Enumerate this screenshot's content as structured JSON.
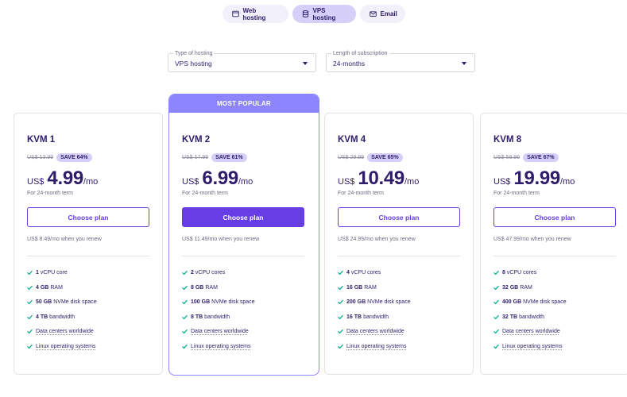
{
  "tabs": [
    {
      "label": "Web hosting",
      "icon": "browser-window-icon",
      "active": false
    },
    {
      "label": "VPS hosting",
      "icon": "server-database-icon",
      "active": true
    },
    {
      "label": "Email",
      "icon": "envelope-icon",
      "active": false
    }
  ],
  "filters": {
    "hosting_type": {
      "label": "Type of hosting",
      "value": "VPS hosting"
    },
    "subscription_length": {
      "label": "Length of subscription",
      "value": "24-months"
    }
  },
  "popular_label": "MOST POPULAR",
  "colors": {
    "accent": "#673de6",
    "popular": "#8c85ff",
    "badge": "#d5cffa",
    "check": "#00b090",
    "text": "#2f1c6a"
  },
  "plans": [
    {
      "name": "KVM 1",
      "old_price": "US$ 13.99",
      "save": "SAVE 64%",
      "currency": "US$",
      "price": "4.99",
      "per": "/mo",
      "term": "For 24-month term",
      "cta": "Choose plan",
      "renew": "US$ 8.49/mo when you renew",
      "features": [
        {
          "bold": "1",
          "text": "vCPU core"
        },
        {
          "bold": "4 GB",
          "text": "RAM"
        },
        {
          "bold": "50 GB",
          "text": "NVMe disk space"
        },
        {
          "bold": "4 TB",
          "text": "bandwidth"
        },
        {
          "bold": "",
          "text": "Data centers worldwide"
        },
        {
          "bold": "",
          "text": "Linux operating systems"
        }
      ]
    },
    {
      "name": "KVM 2",
      "old_price": "US$ 17.99",
      "save": "SAVE 61%",
      "currency": "US$",
      "price": "6.99",
      "per": "/mo",
      "term": "For 24-month term",
      "cta": "Choose plan",
      "renew": "US$ 11.49/mo when you renew",
      "features": [
        {
          "bold": "2",
          "text": "vCPU cores"
        },
        {
          "bold": "8 GB",
          "text": "RAM"
        },
        {
          "bold": "100 GB",
          "text": "NVMe disk space"
        },
        {
          "bold": "8 TB",
          "text": "bandwidth"
        },
        {
          "bold": "",
          "text": "Data centers worldwide"
        },
        {
          "bold": "",
          "text": "Linux operating systems"
        }
      ]
    },
    {
      "name": "KVM 4",
      "old_price": "US$ 29.99",
      "save": "SAVE 65%",
      "currency": "US$",
      "price": "10.49",
      "per": "/mo",
      "term": "For 24-month term",
      "cta": "Choose plan",
      "renew": "US$ 24.99/mo when you renew",
      "features": [
        {
          "bold": "4",
          "text": "vCPU cores"
        },
        {
          "bold": "16 GB",
          "text": "RAM"
        },
        {
          "bold": "200 GB",
          "text": "NVMe disk space"
        },
        {
          "bold": "16 TB",
          "text": "bandwidth"
        },
        {
          "bold": "",
          "text": "Data centers worldwide"
        },
        {
          "bold": "",
          "text": "Linux operating systems"
        }
      ]
    },
    {
      "name": "KVM 8",
      "old_price": "US$ 59.99",
      "save": "SAVE 67%",
      "currency": "US$",
      "price": "19.99",
      "per": "/mo",
      "term": "For 24-month term",
      "cta": "Choose plan",
      "renew": "US$ 47.99/mo when you renew",
      "features": [
        {
          "bold": "8",
          "text": "vCPU cores"
        },
        {
          "bold": "32 GB",
          "text": "RAM"
        },
        {
          "bold": "400 GB",
          "text": "NVMe disk space"
        },
        {
          "bold": "32 TB",
          "text": "bandwidth"
        },
        {
          "bold": "",
          "text": "Data centers worldwide"
        },
        {
          "bold": "",
          "text": "Linux operating systems"
        }
      ]
    }
  ]
}
